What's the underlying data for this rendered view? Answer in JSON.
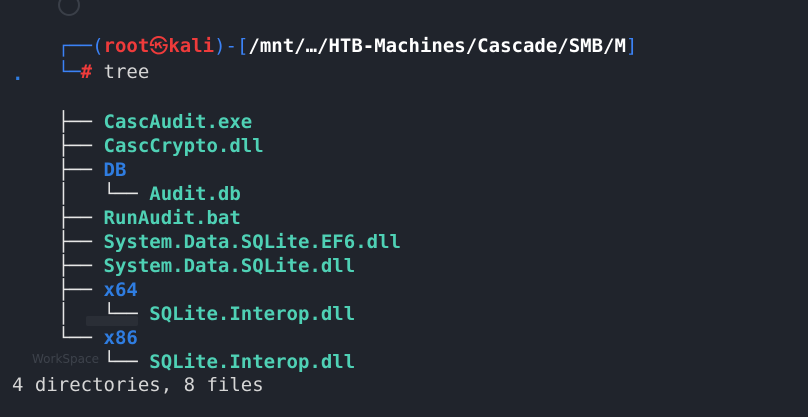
{
  "prompt": {
    "corner_top": "┌──(",
    "user": "root",
    "skull": "㉿",
    "host": "kali",
    "bracket_mid": ")-[",
    "path": "/mnt/…/HTB-Machines/Cascade/SMB/M",
    "bracket_end": "]",
    "corner_bottom": "└─",
    "hash": "#",
    "command": " tree"
  },
  "tree": {
    "root": ".",
    "entries": [
      {
        "prefix": "├── ",
        "name": "CascAudit.exe",
        "type": "file"
      },
      {
        "prefix": "├── ",
        "name": "CascCrypto.dll",
        "type": "file"
      },
      {
        "prefix": "├── ",
        "name": "DB",
        "type": "dir"
      },
      {
        "prefix": "│   └── ",
        "name": "Audit.db",
        "type": "file"
      },
      {
        "prefix": "├── ",
        "name": "RunAudit.bat",
        "type": "file"
      },
      {
        "prefix": "├── ",
        "name": "System.Data.SQLite.EF6.dll",
        "type": "file"
      },
      {
        "prefix": "├── ",
        "name": "System.Data.SQLite.dll",
        "type": "file"
      },
      {
        "prefix": "├── ",
        "name": "x64",
        "type": "dir"
      },
      {
        "prefix": "│   └── ",
        "name": "SQLite.Interop.dll",
        "type": "file"
      },
      {
        "prefix": "└── ",
        "name": "x86",
        "type": "dir"
      },
      {
        "prefix": "    └── ",
        "name": "SQLite.Interop.dll",
        "type": "file"
      }
    ]
  },
  "summary": "4 directories, 8 files",
  "ghost": {
    "label": "WorkSpace"
  },
  "colors": {
    "background": "#20242c",
    "prompt_blue": "#3b82f6",
    "prompt_red": "#ef3b3b",
    "file_teal": "#4fd1b5",
    "dir_blue": "#2f7de1"
  }
}
